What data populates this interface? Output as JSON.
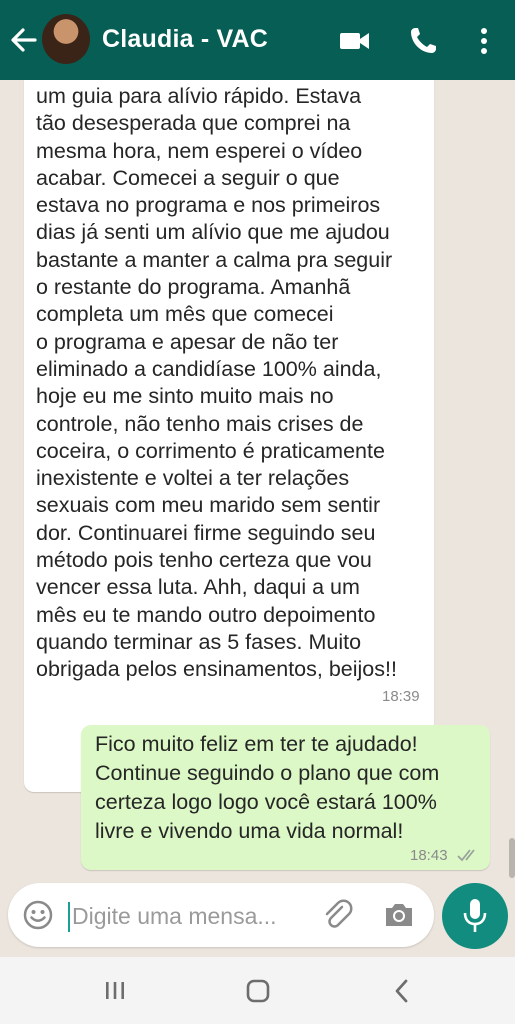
{
  "header": {
    "contact_name": "Claudia - VAC",
    "icons": [
      "back-arrow-icon",
      "avatar",
      "video-call-icon",
      "phone-icon",
      "more-vert-icon"
    ]
  },
  "messages": [
    {
      "direction": "incoming",
      "lines": [
        "um guia para alívio rápido. Estava",
        "tão desesperada que comprei na",
        "mesma hora, nem esperei o vídeo",
        "acabar. Comecei a seguir o que",
        "estava no programa e nos primeiros",
        "dias já senti um alívio que me ajudou",
        "bastante a manter a calma pra seguir",
        "o restante do programa. Amanhã",
        "completa um mês que comecei",
        "o programa e apesar de não ter",
        "eliminado a candidíase 100% ainda,",
        "hoje eu me sinto muito mais no",
        "controle, não tenho mais crises de",
        "coceira, o corrimento é praticamente",
        "inexistente e voltei a ter relações",
        "sexuais com meu marido sem sentir",
        "dor. Continuarei firme seguindo seu",
        "método pois tenho certeza que vou",
        "vencer essa luta. Ahh, daqui a um",
        "mês eu te mando outro depoimento",
        "quando terminar as 5 fases. Muito",
        "obrigada pelos ensinamentos, beijos!!"
      ],
      "time": "18:39"
    },
    {
      "direction": "outgoing",
      "lines": [
        "Fico muito feliz em ter te ajudado!",
        "Continue seguindo o plano que com",
        "certeza logo logo você estará 100%",
        "livre e vivendo uma vida normal!"
      ],
      "time": "18:43",
      "status": "read-ticks-icon"
    }
  ],
  "composer": {
    "placeholder": "Digite uma mensa..."
  },
  "colors": {
    "header": "#075e54",
    "chat_bg": "#ece5dd",
    "incoming_bubble": "#ffffff",
    "outgoing_bubble": "#dcf8c6",
    "mic_button": "#128c7e"
  }
}
